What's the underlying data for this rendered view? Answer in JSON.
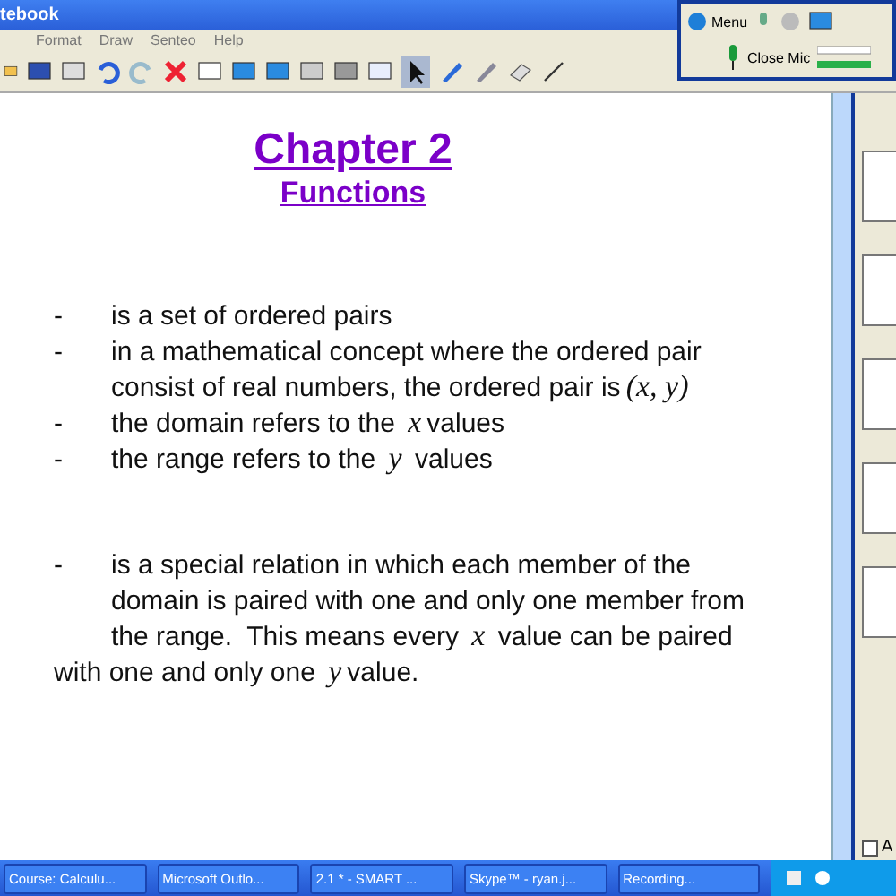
{
  "window": {
    "title": "tebook"
  },
  "menu": [
    "Format",
    "Draw",
    "Senteo",
    "Help"
  ],
  "skype": {
    "menu": "Menu",
    "mic": "Close Mic"
  },
  "slide": {
    "title": "Chapter 2",
    "subtitle": "Functions",
    "lines": [
      {
        "kind": "bullet",
        "dash": "-",
        "text": "is a set of ordered pairs"
      },
      {
        "kind": "bullet",
        "dash": "-",
        "text": "in a mathematical concept where the ordered pair"
      },
      {
        "kind": "cont",
        "text": "consist of real numbers, the ordered pair is",
        "math": "(x, y)"
      },
      {
        "kind": "bullet",
        "dash": "-",
        "text": "the domain refers to the ",
        "math": "x",
        "after": "values"
      },
      {
        "kind": "bullet",
        "dash": "-",
        "text": "the range refers to the ",
        "math": "y",
        "after": " values"
      },
      {
        "kind": "gap"
      },
      {
        "kind": "bullet",
        "dash": "-",
        "text": "is a special relation in which each member of the"
      },
      {
        "kind": "cont",
        "text": "domain is paired with one and only one member from"
      },
      {
        "kind": "cont",
        "text": "the range.  This means every ",
        "math": "x",
        "after": " value can be paired"
      },
      {
        "kind": "out",
        "text": "with one and only one ",
        "math": "y",
        "after": "value."
      }
    ]
  },
  "side_panel": {
    "checkbox_label": "A",
    "checked": false
  },
  "taskbar": [
    {
      "label": "Course: Calculu...",
      "active": false
    },
    {
      "label": "Microsoft Outlo...",
      "active": false
    },
    {
      "label": "2.1 * - SMART ...",
      "active": false
    },
    {
      "label": "Skype™ - ryan.j...",
      "active": false
    },
    {
      "label": "Recording...",
      "active": false
    }
  ]
}
